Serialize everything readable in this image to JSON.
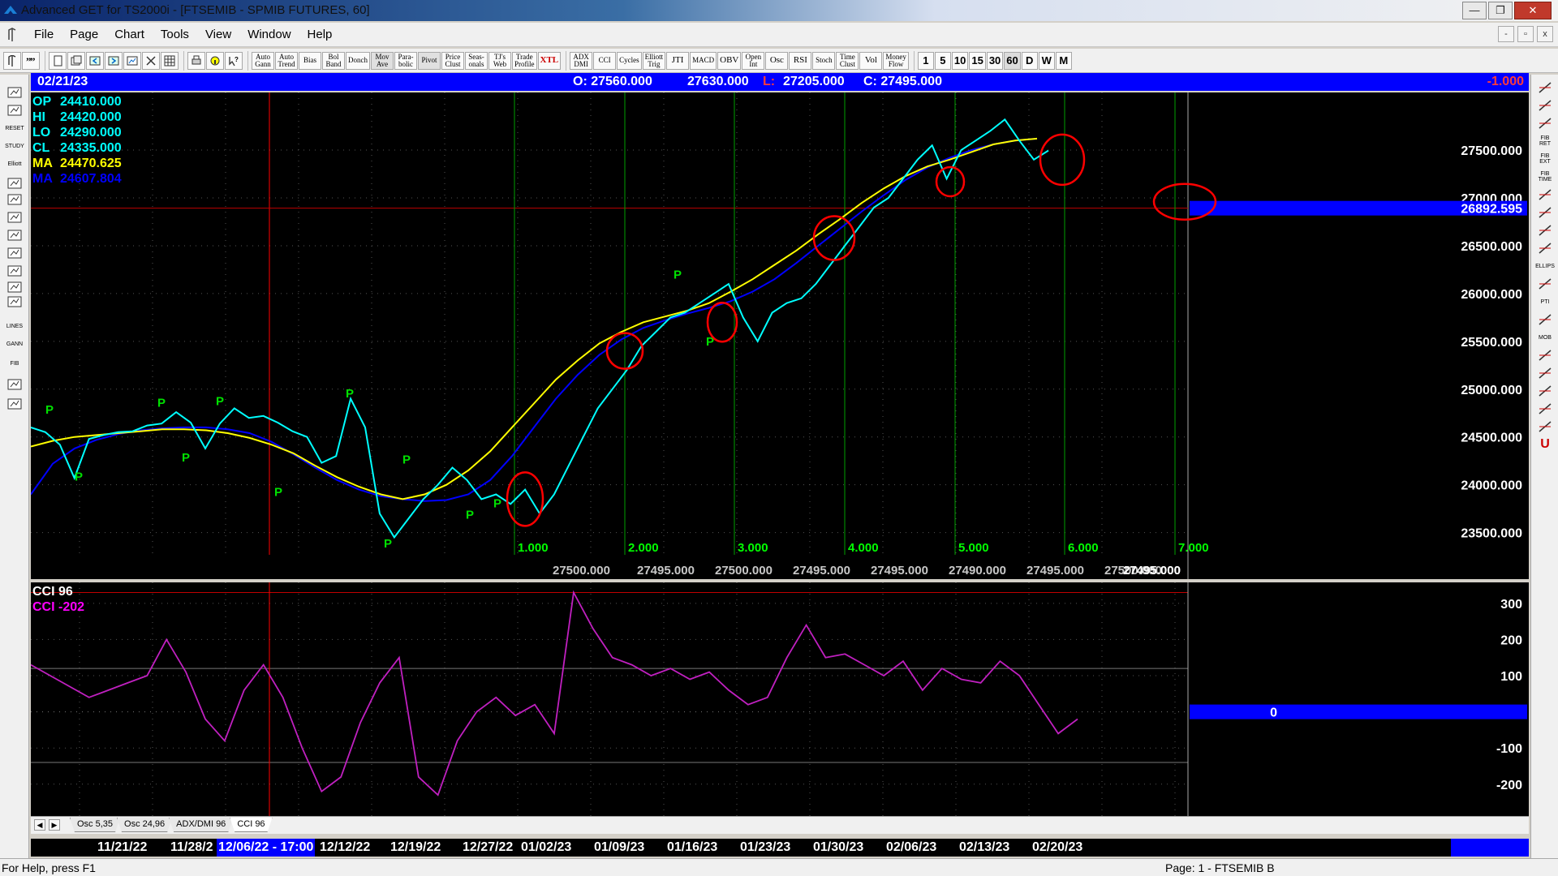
{
  "window": {
    "title": "Advanced GET for TS2000i - [FTSEMIB - SPMIB FUTURES, 60]",
    "controls": {
      "minimize": "—",
      "maximize": "❐",
      "close": "✕"
    }
  },
  "menu": {
    "items": [
      "File",
      "Page",
      "Chart",
      "Tools",
      "View",
      "Window",
      "Help"
    ],
    "mdi_controls": {
      "minimize": "-",
      "restore": "▫",
      "close": "x"
    }
  },
  "toolbar": {
    "studies": [
      "Auto\nGann",
      "Auto\nTrend",
      "Bias",
      "Bol\nBand",
      "Donch",
      "Mov\nAve",
      "Para-\nbolic",
      "Pivot",
      "Price\nClust",
      "Seas-\nonals",
      "TJ's\nWeb",
      "Trade\nProfile",
      "XTL"
    ],
    "indicators": [
      "ADX\nDMI",
      "CCI",
      "Cycles",
      "Elliott\nTrig",
      "JTI",
      "MACD",
      "OBV",
      "Open\nInt",
      "Osc",
      "RSI",
      "Stoch",
      "Time\nClust",
      "Vol",
      "Money\nFlow"
    ],
    "periods": [
      "1",
      "5",
      "10",
      "15",
      "30",
      "60",
      "D",
      "W",
      "M"
    ],
    "active_period": "60"
  },
  "left_tools": {
    "labels": [
      "",
      "",
      "RESET",
      "STUDY",
      "Elliott",
      "",
      "",
      "",
      "",
      "",
      "",
      "",
      "",
      "LINES",
      "GANN",
      "FIB",
      "",
      ""
    ]
  },
  "right_tools": {
    "labels": [
      "",
      "",
      "",
      "FIB RET",
      "FIB EXT",
      "FIB TIME",
      "",
      "",
      "",
      "",
      "ELLIPS",
      "",
      "PTI",
      "",
      "MOB",
      "",
      "",
      "",
      "",
      "",
      "U"
    ]
  },
  "infobar": {
    "date": "02/21/23",
    "open": "O: 27560.000",
    "high": "27630.000",
    "low_label": "L:",
    "low": "27205.000",
    "close": "C: 27495.000",
    "change": "-1.000"
  },
  "price_legend": [
    {
      "label": "OP",
      "value": "24410.000",
      "color": "#00ffff"
    },
    {
      "label": "HI",
      "value": "24420.000",
      "color": "#00ffff"
    },
    {
      "label": "LO",
      "value": "24290.000",
      "color": "#00ffff"
    },
    {
      "label": "CL",
      "value": "24335.000",
      "color": "#00ffff"
    },
    {
      "label": "MA",
      "value": "24470.625",
      "color": "#ffff00"
    },
    {
      "label": "MA",
      "value": "24607.804",
      "color": "#0000ff"
    }
  ],
  "cci_legend": [
    {
      "label": "CCI 96",
      "color": "#ffffff"
    },
    {
      "label": "CCI  -202",
      "color": "#ff00ff"
    }
  ],
  "colors": {
    "price_line": "#00ffff",
    "ma_fast": "#ffff00",
    "ma_slow": "#0000ff",
    "cycle_lines": "#00a000",
    "red_marks": "#ff0000",
    "cci_line": "#c020c0",
    "pivot_label": "#00e000",
    "axis_text": "#ffffff"
  },
  "chart_data": [
    {
      "type": "line",
      "name": "FTSEMIB - SPMIB FUTURES 60 min",
      "y_ticks": [
        23500,
        24000,
        24500,
        25000,
        25500,
        26000,
        26500,
        27000,
        27500
      ],
      "y_tick_labels": [
        "23500.000",
        "24000.000",
        "24500.000",
        "25000.000",
        "25500.000",
        "26000.000",
        "26500.000",
        "27000.000",
        "27500.000"
      ],
      "ylim": [
        23200,
        27950
      ],
      "current_price_label": "26892.595",
      "current_price": 26892.595,
      "series": [
        {
          "name": "CL",
          "values": [
            24600,
            24550,
            24420,
            24070,
            24480,
            24520,
            24550,
            24560,
            24620,
            24640,
            24760,
            24650,
            24380,
            24640,
            24800,
            24700,
            24720,
            24650,
            24560,
            24500,
            24230,
            24300,
            24900,
            24600,
            23700,
            23450,
            23650,
            23850,
            24000,
            24180,
            24050,
            23850,
            23900,
            23800,
            23950,
            23700,
            23900,
            24200,
            24500,
            24800,
            25000,
            25200,
            25450,
            25600,
            25750,
            25800,
            25900,
            26000,
            26100,
            25750,
            25500,
            25800,
            25900,
            25950,
            26100,
            26300,
            26500,
            26700,
            26900,
            27000,
            27200,
            27400,
            27550,
            27200,
            27500,
            27600,
            27700,
            27820,
            27600,
            27400,
            27495
          ]
        },
        {
          "name": "MA",
          "values": [
            24400,
            24460,
            24500,
            24520,
            24540,
            24560,
            24580,
            24580,
            24570,
            24540,
            24490,
            24420,
            24330,
            24200,
            24080,
            23980,
            23900,
            23850,
            23900,
            24000,
            24150,
            24350,
            24600,
            24850,
            25100,
            25300,
            25480,
            25600,
            25700,
            25760,
            25820,
            25900,
            26020,
            26150,
            26300,
            26450,
            26620,
            26780,
            26950,
            27100,
            27230,
            27330,
            27400,
            27480,
            27560,
            27600,
            27620
          ]
        },
        {
          "name": "MA",
          "values": [
            23900,
            24220,
            24380,
            24470,
            24530,
            24570,
            24590,
            24600,
            24600,
            24580,
            24540,
            24450,
            24320,
            24180,
            24050,
            23950,
            23880,
            23850,
            23830,
            23840,
            23900,
            24050,
            24300,
            24600,
            24900,
            25150,
            25360,
            25520,
            25640,
            25720,
            25790,
            25850,
            25920,
            26020,
            26150,
            26320,
            26500,
            26680,
            26860,
            27030,
            27190,
            27320,
            27420,
            27500,
            27560,
            27600,
            27620
          ]
        }
      ],
      "cycle_labels": [
        "1.000",
        "2.000",
        "3.000",
        "4.000",
        "5.000",
        "6.000",
        "7.000"
      ],
      "pivot_label": "P",
      "projection_labels": [
        "27500.000",
        "27495.000",
        "27500.000",
        "27495.000",
        "27495.000",
        "27490.000",
        "27495.000",
        "27500.000",
        "27495.000",
        "27495.000"
      ]
    },
    {
      "type": "line",
      "name": "CCI 96",
      "y_ticks": [
        300,
        200,
        100,
        0,
        -100,
        -200
      ],
      "y_tick_labels": [
        "300",
        "200",
        "100",
        "0",
        "-100",
        "-200"
      ],
      "ylim": [
        -270,
        340
      ],
      "current_value": -202,
      "values": [
        130,
        100,
        70,
        40,
        60,
        80,
        100,
        200,
        110,
        -20,
        -80,
        60,
        130,
        40,
        -100,
        -220,
        -180,
        -30,
        80,
        150,
        -180,
        -230,
        -80,
        0,
        40,
        -10,
        20,
        -60,
        330,
        230,
        150,
        130,
        100,
        120,
        90,
        110,
        60,
        20,
        40,
        150,
        240,
        150,
        160,
        130,
        100,
        140,
        60,
        120,
        90,
        80,
        140,
        100,
        20,
        -60,
        -20
      ]
    }
  ],
  "tabs": {
    "nav": [
      "◀",
      "▶"
    ],
    "items": [
      "Osc 5,35",
      "Osc 24,96",
      "ADX/DMI 96",
      "CCI 96"
    ],
    "active": "CCI 96"
  },
  "dates": {
    "labels": [
      "11/21/22",
      "11/28/2",
      "12/06/22 - 17:00",
      "12/12/22",
      "12/19/22",
      "12/27/22",
      "01/02/23",
      "01/09/23",
      "01/16/23",
      "01/23/23",
      "01/30/23",
      "02/06/23",
      "02/13/23",
      "02/20/23"
    ],
    "selected": "12/06/22 - 17:00"
  },
  "status": {
    "help": "For Help, press F1",
    "page": "Page: 1 - FTSEMIB B"
  }
}
